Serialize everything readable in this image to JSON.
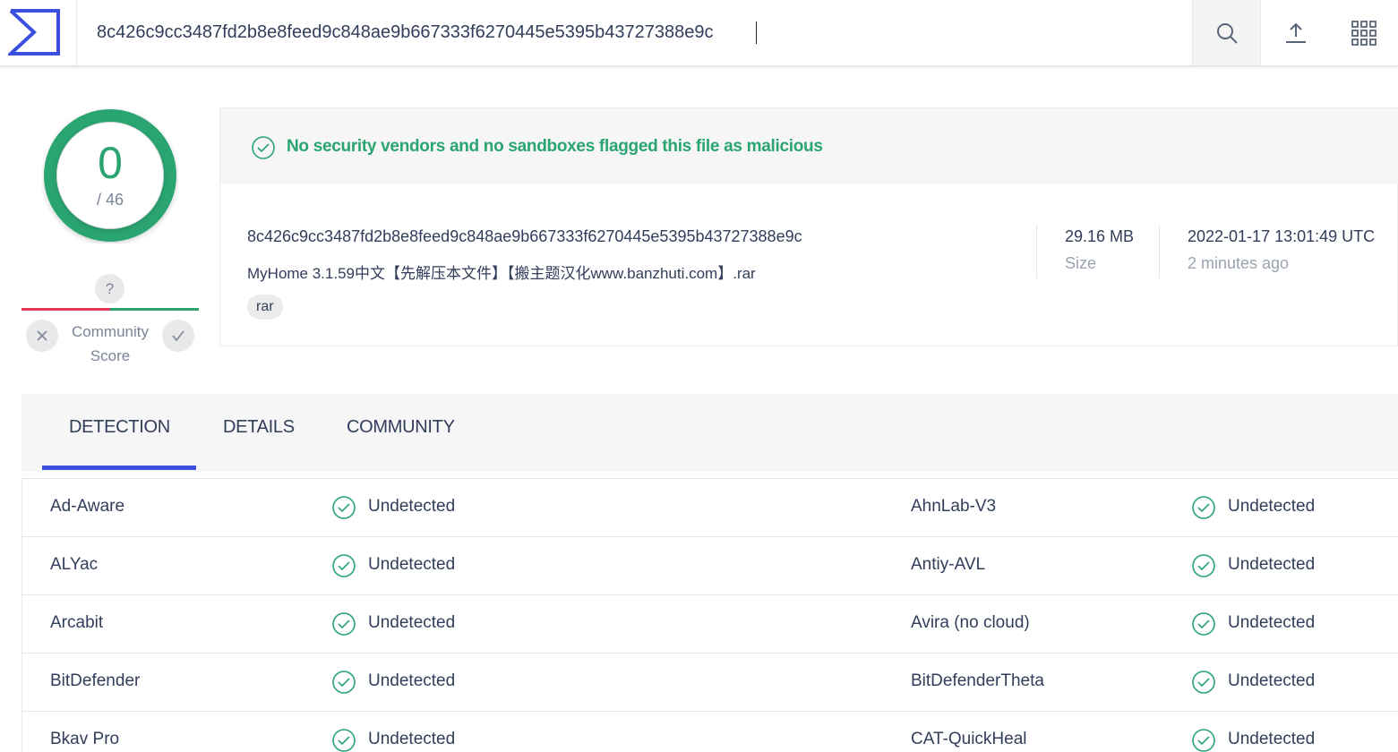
{
  "search": {
    "value": "8c426c9cc3487fd2b8e8feed9c848ae9b667333f6270445e5395b43727388e9c"
  },
  "icons": {
    "logo": "sigma-logo-icon",
    "search": "search-icon",
    "upload": "upload-icon",
    "apps": "apps-grid-icon",
    "check": "check-circle-icon"
  },
  "score": {
    "detected": "0",
    "total": "/ 46"
  },
  "community": {
    "badge": "?",
    "label": "Community Score"
  },
  "summary": {
    "message": "No security vendors and no sandboxes flagged this file as malicious",
    "hash": "8c426c9cc3487fd2b8e8feed9c848ae9b667333f6270445e5395b43727388e9c",
    "filename": "MyHome 3.1.59中文【先解压本文件】【搬主题汉化www.banzhuti.com】.rar",
    "tag": "rar",
    "size_value": "29.16 MB",
    "size_label": "Size",
    "date_value": "2022-01-17 13:01:49 UTC",
    "date_label": "2 minutes ago"
  },
  "tabs": [
    {
      "label": "DETECTION"
    },
    {
      "label": "DETAILS"
    },
    {
      "label": "COMMUNITY"
    }
  ],
  "detections": [
    {
      "left_vendor": "Ad-Aware",
      "left_result": "Undetected",
      "right_vendor": "AhnLab-V3",
      "right_result": "Undetected"
    },
    {
      "left_vendor": "ALYac",
      "left_result": "Undetected",
      "right_vendor": "Antiy-AVL",
      "right_result": "Undetected"
    },
    {
      "left_vendor": "Arcabit",
      "left_result": "Undetected",
      "right_vendor": "Avira (no cloud)",
      "right_result": "Undetected"
    },
    {
      "left_vendor": "BitDefender",
      "left_result": "Undetected",
      "right_vendor": "BitDefenderTheta",
      "right_result": "Undetected"
    },
    {
      "left_vendor": "Bkav Pro",
      "left_result": "Undetected",
      "right_vendor": "CAT-QuickHeal",
      "right_result": "Undetected"
    }
  ],
  "colors": {
    "accent": "#3b50e0",
    "clean": "#2aa471",
    "malicious": "#e8385a"
  }
}
